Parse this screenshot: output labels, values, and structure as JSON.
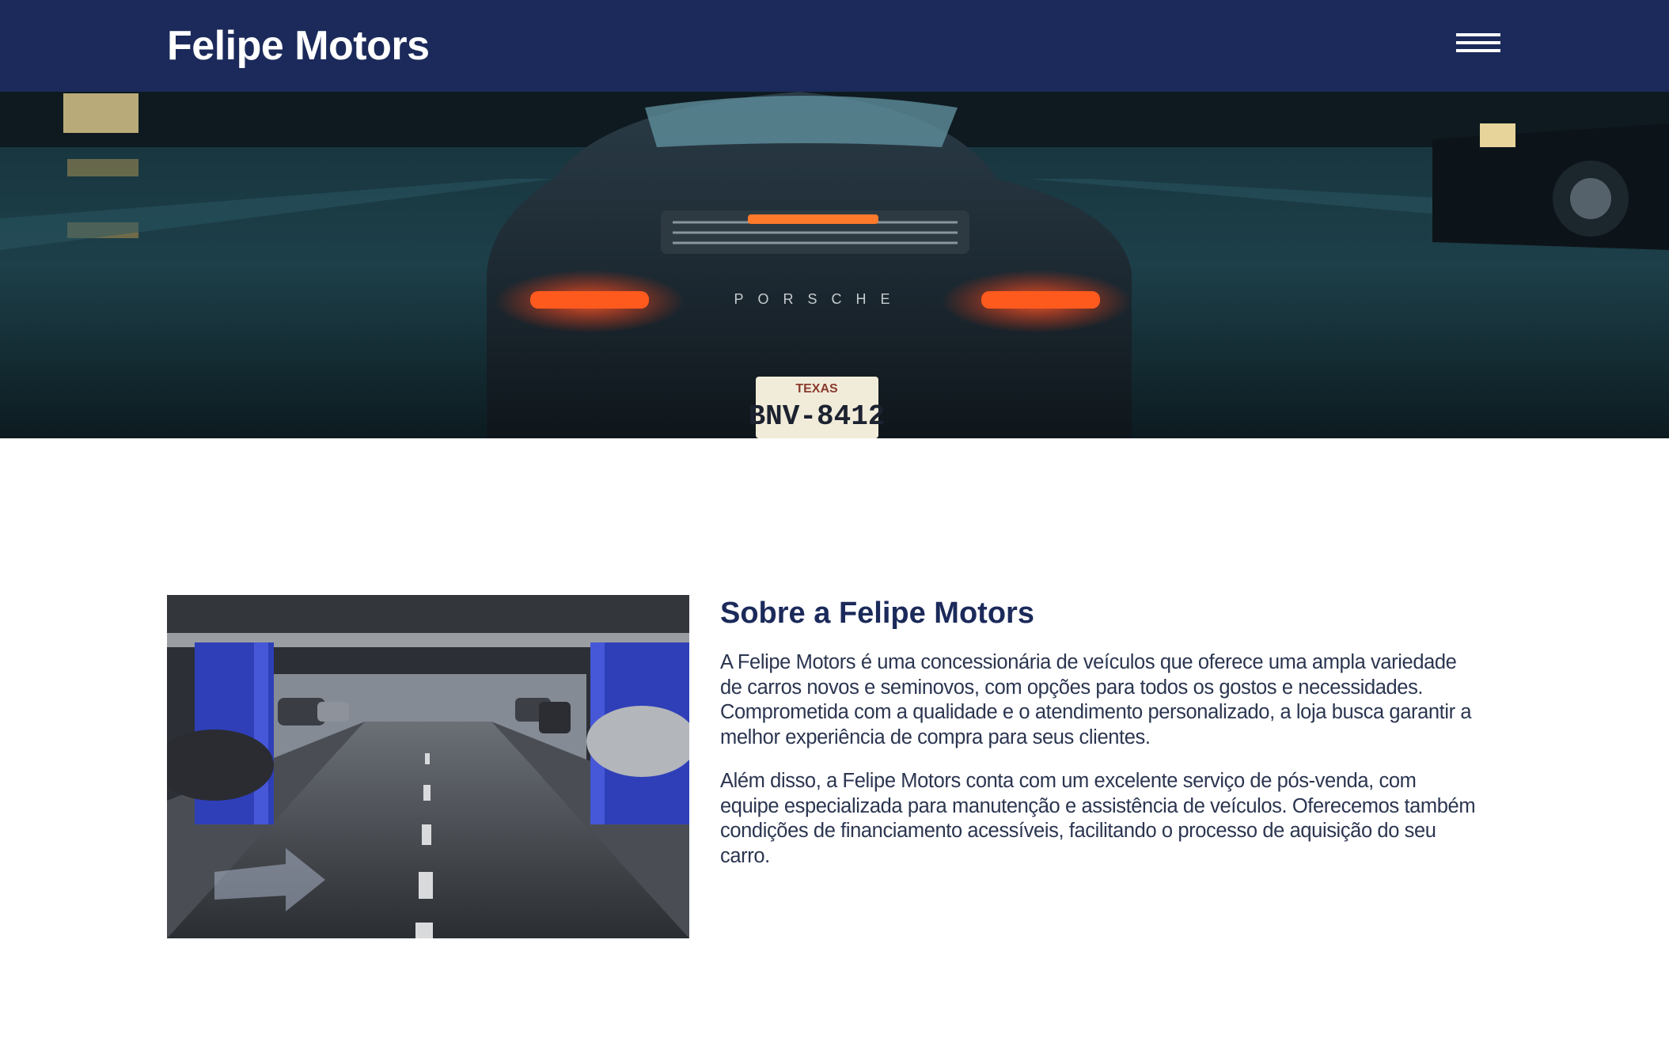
{
  "header": {
    "brand": "Felipe Motors",
    "menu_icon": "hamburger-menu-icon",
    "background_color": "#1b2a5a"
  },
  "hero": {
    "image": "rear-of-car-on-wet-street-at-night",
    "plate_state": "TEXAS",
    "plate_number": "BNV-8412",
    "car_badge": "PORSCHE"
  },
  "about": {
    "image": "underground-parking-garage",
    "title": "Sobre a Felipe Motors",
    "paragraphs": [
      "A Felipe Motors é uma concessionária de veículos que oferece uma ampla variedade de carros novos e seminovos, com opções para todos os gostos e necessidades. Comprometida com a qualidade e o atendimento personalizado, a loja busca garantir a melhor experiência de compra para seus clientes.",
      "Além disso, a Felipe Motors conta com um excelente serviço de pós-venda, com equipe especializada para manutenção e assistência de veículos. Oferecemos também condições de financiamento acessíveis, facilitando o processo de aquisição do seu carro."
    ],
    "title_color": "#1b2a5a"
  }
}
